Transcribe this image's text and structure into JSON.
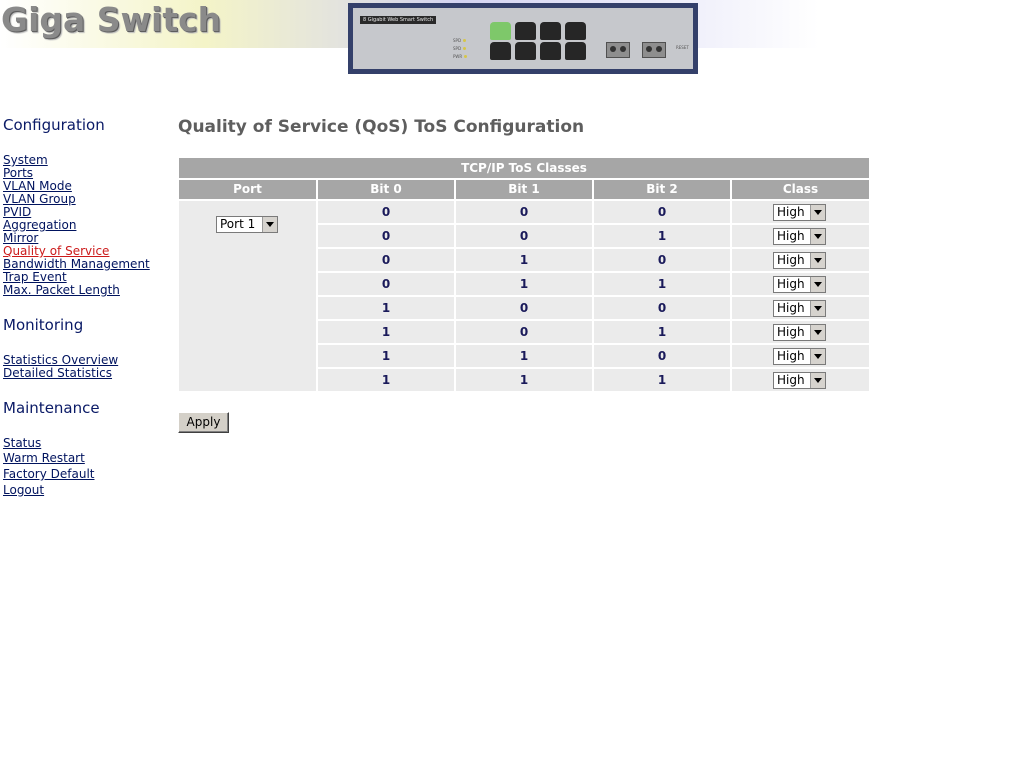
{
  "header": {
    "logo_text": "Giga Switch",
    "device_label": "8 Gigabit Web Smart Switch"
  },
  "sidebar": {
    "configuration_title": "Configuration",
    "configuration_links": [
      "System",
      "Ports",
      "VLAN Mode",
      "VLAN Group",
      "PVID",
      "Aggregation",
      "Mirror",
      "Quality of Service",
      "Bandwidth Management",
      "Trap Event",
      "Max. Packet Length"
    ],
    "active_link": "Quality of Service",
    "monitoring_title": "Monitoring",
    "monitoring_links": [
      "Statistics Overview",
      "Detailed Statistics"
    ],
    "maintenance_title": "Maintenance",
    "maintenance_links": [
      "Status",
      "Warm Restart",
      "Factory Default",
      "Logout"
    ]
  },
  "main": {
    "page_title": "Quality of Service (QoS) ToS Configuration",
    "table": {
      "caption": "TCP/IP ToS Classes",
      "headers": [
        "Port",
        "Bit 0",
        "Bit 1",
        "Bit 2",
        "Class"
      ],
      "port_select": "Port 1",
      "rows": [
        {
          "bit0": "0",
          "bit1": "0",
          "bit2": "0",
          "class": "High"
        },
        {
          "bit0": "0",
          "bit1": "0",
          "bit2": "1",
          "class": "High"
        },
        {
          "bit0": "0",
          "bit1": "1",
          "bit2": "0",
          "class": "High"
        },
        {
          "bit0": "0",
          "bit1": "1",
          "bit2": "1",
          "class": "High"
        },
        {
          "bit0": "1",
          "bit1": "0",
          "bit2": "0",
          "class": "High"
        },
        {
          "bit0": "1",
          "bit1": "0",
          "bit2": "1",
          "class": "High"
        },
        {
          "bit0": "1",
          "bit1": "1",
          "bit2": "0",
          "class": "High"
        },
        {
          "bit0": "1",
          "bit1": "1",
          "bit2": "1",
          "class": "High"
        }
      ]
    },
    "apply_label": "Apply"
  },
  "colors": {
    "header_cell": "#a6a6a6",
    "body_cell": "#ebebeb",
    "nav_link": "#00135e",
    "nav_active": "#cc1b1b",
    "section_title": "#0a1a66"
  }
}
